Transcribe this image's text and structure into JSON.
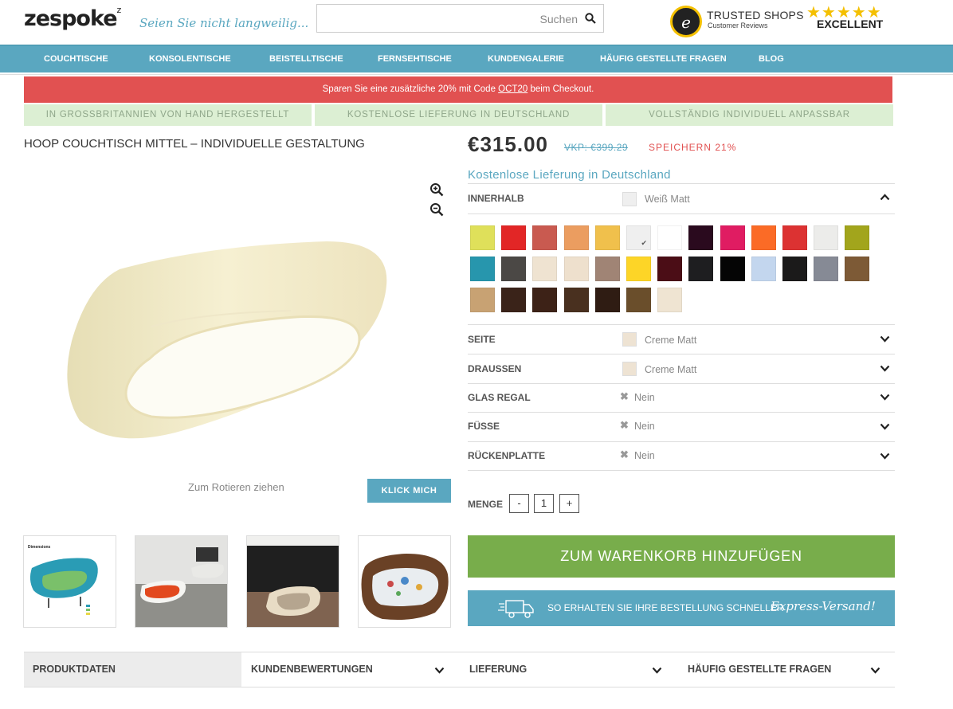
{
  "header": {
    "logo": "zespoke",
    "logo_mark": "z",
    "tagline": "Seien Sie nicht langweilig...",
    "search_label": "Suchen",
    "trusted_title": "TRUSTED SHOPS",
    "trusted_sub": "Customer Reviews",
    "trusted_seal_letter": "e",
    "stars": "★★★★★",
    "rating_text": "EXCELLENT"
  },
  "nav": [
    "COUCHTISCHE",
    "KONSOLENTISCHE",
    "BEISTELLTISCHE",
    "FERNSEHTISCHE",
    "KUNDENGALERIE",
    "HÄUFIG GESTELLTE FRAGEN",
    "BLOG"
  ],
  "promo": {
    "before": "Sparen Sie eine zusätzliche 20% mit Code ",
    "code": "OCT20",
    "after": " beim Checkout."
  },
  "usps": [
    "IN GROSSBRITANNIEN VON HAND HERGESTELLT",
    "KOSTENLOSE LIEFERUNG IN DEUTSCHLAND",
    "VOLLSTÄNDIG INDIVIDUELL ANPASSBAR"
  ],
  "product": {
    "title": "HOOP COUCHTISCH MITTEL – INDIVIDUELLE GESTALTUNG",
    "rotate_hint": "Zum Rotieren ziehen",
    "click_label": "KLICK MICH",
    "thumb_dimensions": "Dimensions"
  },
  "pricing": {
    "price": "€315.00",
    "rrp": "VKP: €399.29",
    "saving": "SPEICHERN 21%",
    "free_delivery": "Kostenlose Lieferung in Deutschland"
  },
  "options": {
    "innerhalb": {
      "label": "INNERHALB",
      "value": "Weiß Matt",
      "swatch_color": "#efefef"
    },
    "seite": {
      "label": "SEITE",
      "value": "Creme Matt",
      "swatch_color": "#eee3d3"
    },
    "draussen": {
      "label": "DRAUSSEN",
      "value": "Creme Matt",
      "swatch_color": "#eee3d3"
    },
    "glas": {
      "label": "GLAS REGAL",
      "value": "Nein"
    },
    "fuesse": {
      "label": "FÜSSE",
      "value": "Nein"
    },
    "rueckenplatte": {
      "label": "RÜCKENPLATTE",
      "value": "Nein"
    }
  },
  "swatches": [
    "#dfe05a",
    "#e22626",
    "#c95a50",
    "#eb9d60",
    "#f0c04c",
    "#efefef",
    "#ffffff",
    "#2a0a1e",
    "#e01c62",
    "#fb6b26",
    "#dc3232",
    "#ececea",
    "#a2a51c",
    "#2796ad",
    "#4b4845",
    "#efe3d1",
    "#eee0cd",
    "#a08475",
    "#fdd527",
    "#4b0d16",
    "#1e1e20",
    "#050505",
    "#c3d6ee",
    "#1b1a1a",
    "#868a95",
    "#7d5a36",
    "#c8a273",
    "#3a2319",
    "#3d2217",
    "#49301f",
    "#2f1c13",
    "#6a4e2b",
    "#efe4d2"
  ],
  "selected_swatch": 5,
  "quantity": {
    "label": "MENGE",
    "minus": "-",
    "value": "1",
    "plus": "+"
  },
  "cart_label": "ZUM WARENKORB HINZUFÜGEN",
  "express": {
    "text": "SO ERHALTEN SIE IHRE BESTELLUNG SCHNELLER",
    "script": "Express-Versand!"
  },
  "tabs": [
    "PRODUKTDATEN",
    "KUNDENBEWERTUNGEN",
    "LIEFERUNG",
    "HÄUFIG GESTELLTE FRAGEN"
  ]
}
